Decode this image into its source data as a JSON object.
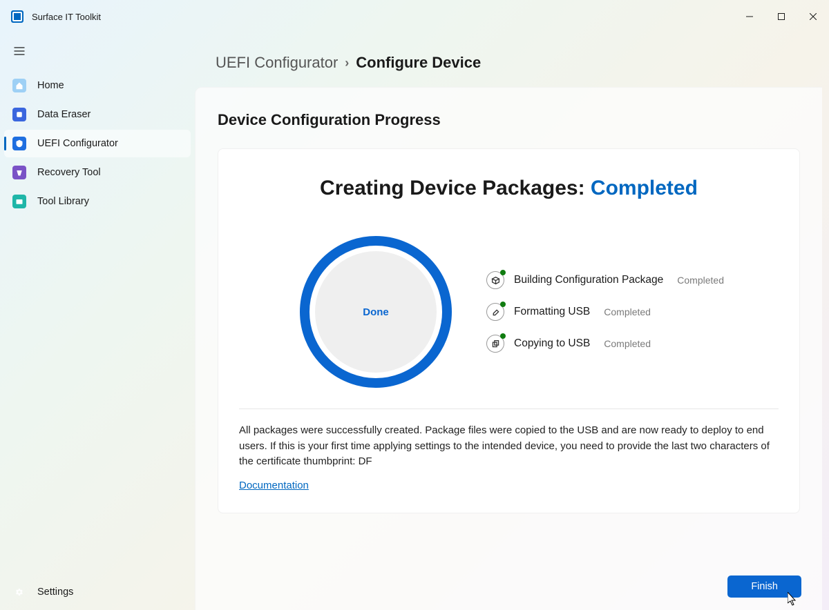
{
  "app": {
    "title": "Surface IT Toolkit"
  },
  "sidebar": {
    "items": [
      {
        "label": "Home"
      },
      {
        "label": "Data Eraser"
      },
      {
        "label": "UEFI Configurator"
      },
      {
        "label": "Recovery Tool"
      },
      {
        "label": "Tool Library"
      }
    ],
    "settings_label": "Settings"
  },
  "breadcrumb": {
    "root": "UEFI Configurator",
    "current": "Configure Device"
  },
  "main": {
    "section_title": "Device Configuration Progress",
    "status_prefix": "Creating Device Packages:",
    "status_value": "Completed",
    "ring_label": "Done",
    "steps": [
      {
        "label": "Building Configuration Package",
        "status": "Completed"
      },
      {
        "label": "Formatting USB",
        "status": "Completed"
      },
      {
        "label": "Copying to USB",
        "status": "Completed"
      }
    ],
    "result_text": "All packages were successfully created. Package files were copied to the USB and are now ready to deploy to end users. If this is your first time applying settings to the intended device, you need to provide the last two characters of the certificate thumbprint: DF",
    "documentation_label": "Documentation",
    "finish_label": "Finish"
  }
}
